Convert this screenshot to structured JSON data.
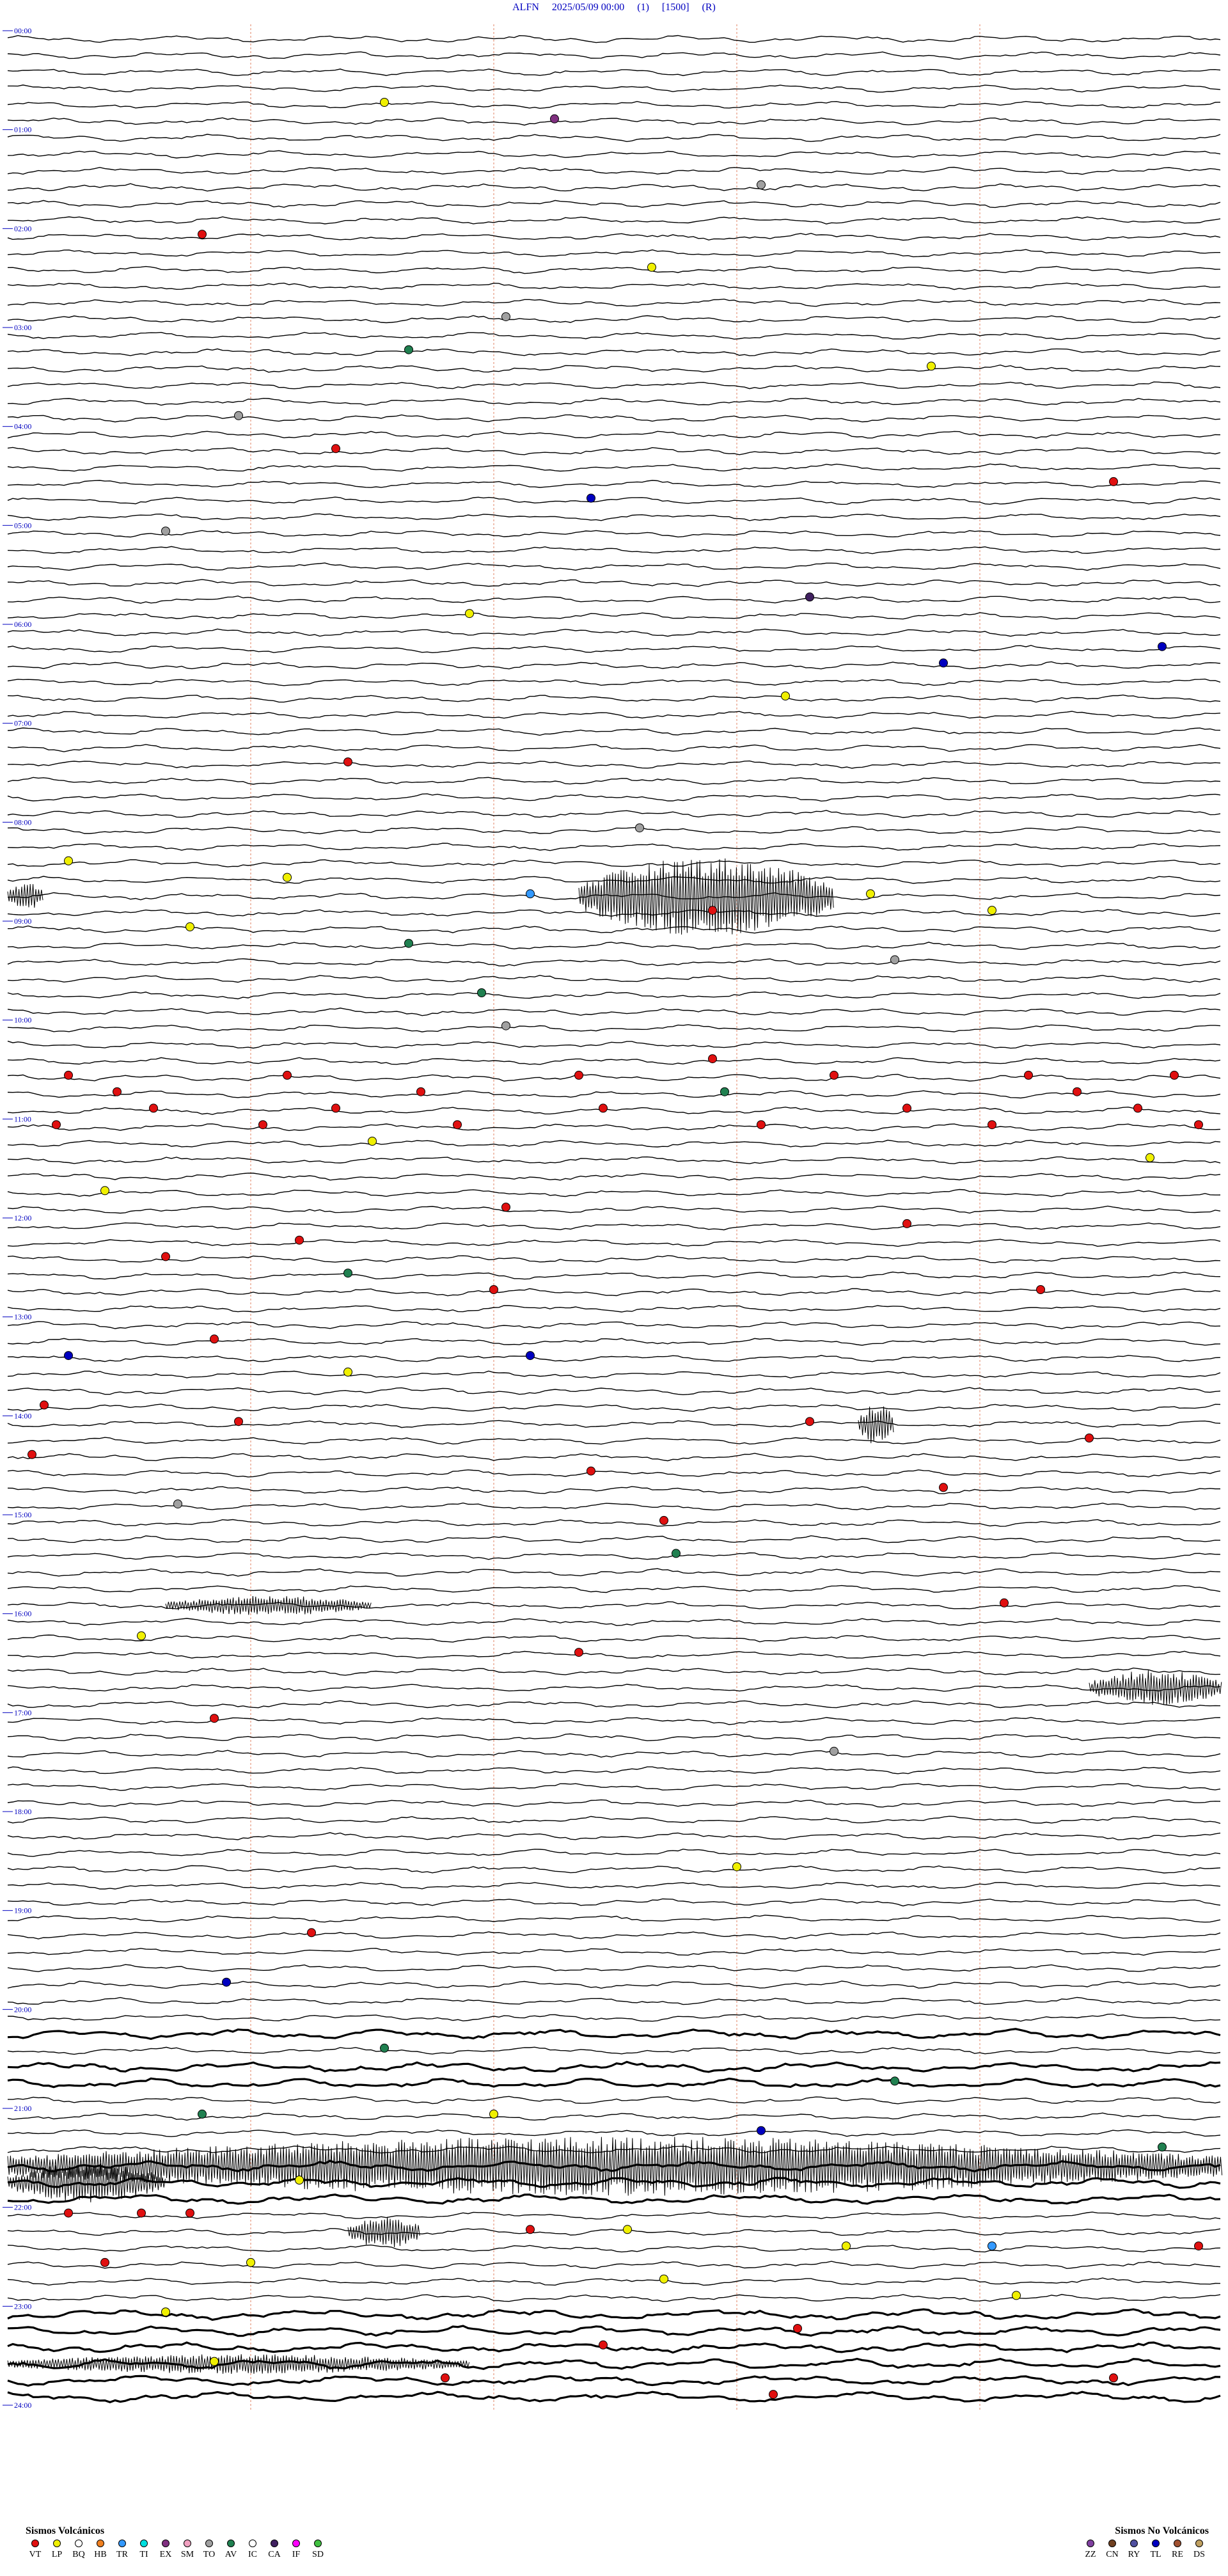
{
  "header": {
    "station": "ALFN",
    "datetime": "2025/05/09 00:00",
    "p1": "(1)",
    "p2": "[1500]",
    "p3": "(R)"
  },
  "chart_data": {
    "type": "line",
    "description_free": true,
    "traces_per_hour": 6,
    "row_count": 144,
    "hours": 24,
    "hour_labels": [
      "00:00",
      "01:00",
      "02:00",
      "03:00",
      "04:00",
      "05:00",
      "06:00",
      "07:00",
      "08:00",
      "09:00",
      "10:00",
      "11:00",
      "12:00",
      "13:00",
      "14:00",
      "15:00",
      "16:00",
      "17:00",
      "18:00",
      "19:00",
      "20:00",
      "21:00",
      "22:00",
      "23:00",
      "24:00"
    ],
    "x_minutes": [
      0,
      10
    ],
    "colors": {
      "VT": "#e01010",
      "LP": "#f0f000",
      "BQ": "#ffffff",
      "HB": "#f08020",
      "TR": "#3399ff",
      "TI": "#00e0e0",
      "EX": "#803080",
      "SM": "#f0a0c0",
      "TO": "#a0a0a0",
      "AV": "#208050",
      "IC": "#ffffff",
      "CA": "#402060",
      "IF": "#ff00ff",
      "SD": "#40c040",
      "ZZ": "#8040a0",
      "CN": "#704020",
      "RY": "#5050a0",
      "TL": "#0000c0",
      "RE": "#a05030",
      "DS": "#c0a060"
    },
    "events": [
      {
        "row": 4,
        "t": 3.1,
        "k": "LP"
      },
      {
        "row": 5,
        "t": 4.5,
        "k": "EX"
      },
      {
        "row": 9,
        "t": 6.2,
        "k": "TO"
      },
      {
        "row": 12,
        "t": 1.6,
        "k": "VT"
      },
      {
        "row": 14,
        "t": 5.3,
        "k": "LP"
      },
      {
        "row": 17,
        "t": 4.1,
        "k": "TO"
      },
      {
        "row": 19,
        "t": 3.3,
        "k": "AV"
      },
      {
        "row": 20,
        "t": 7.6,
        "k": "LP"
      },
      {
        "row": 23,
        "t": 1.9,
        "k": "TO"
      },
      {
        "row": 25,
        "t": 2.7,
        "k": "VT"
      },
      {
        "row": 27,
        "t": 9.1,
        "k": "VT"
      },
      {
        "row": 28,
        "t": 4.8,
        "k": "TL"
      },
      {
        "row": 30,
        "t": 1.3,
        "k": "TO"
      },
      {
        "row": 34,
        "t": 6.6,
        "k": "CA"
      },
      {
        "row": 35,
        "t": 3.8,
        "k": "LP"
      },
      {
        "row": 37,
        "t": 9.5,
        "k": "TL"
      },
      {
        "row": 38,
        "t": 7.7,
        "k": "TL"
      },
      {
        "row": 40,
        "t": 6.4,
        "k": "LP"
      },
      {
        "row": 44,
        "t": 2.8,
        "k": "VT"
      },
      {
        "row": 48,
        "t": 5.2,
        "k": "TO"
      },
      {
        "row": 50,
        "t": 0.5,
        "k": "LP"
      },
      {
        "row": 51,
        "t": 2.3,
        "k": "LP"
      },
      {
        "row": 52,
        "t": 4.3,
        "k": "TR"
      },
      {
        "row": 52,
        "t": 7.1,
        "k": "LP"
      },
      {
        "row": 53,
        "t": 5.8,
        "k": "VT"
      },
      {
        "row": 53,
        "t": 8.1,
        "k": "LP"
      },
      {
        "row": 54,
        "t": 1.5,
        "k": "LP"
      },
      {
        "row": 55,
        "t": 3.3,
        "k": "AV"
      },
      {
        "row": 56,
        "t": 7.3,
        "k": "TO"
      },
      {
        "row": 58,
        "t": 3.9,
        "k": "AV"
      },
      {
        "row": 60,
        "t": 4.1,
        "k": "TO"
      },
      {
        "row": 62,
        "t": 5.8,
        "k": "VT"
      },
      {
        "row": 63,
        "t": 0.5,
        "k": "VT"
      },
      {
        "row": 63,
        "t": 2.3,
        "k": "VT"
      },
      {
        "row": 63,
        "t": 4.7,
        "k": "VT"
      },
      {
        "row": 63,
        "t": 6.8,
        "k": "VT"
      },
      {
        "row": 63,
        "t": 8.4,
        "k": "VT"
      },
      {
        "row": 63,
        "t": 9.6,
        "k": "VT"
      },
      {
        "row": 64,
        "t": 0.9,
        "k": "VT"
      },
      {
        "row": 64,
        "t": 3.4,
        "k": "VT"
      },
      {
        "row": 64,
        "t": 5.9,
        "k": "AV"
      },
      {
        "row": 64,
        "t": 8.8,
        "k": "VT"
      },
      {
        "row": 65,
        "t": 1.2,
        "k": "VT"
      },
      {
        "row": 65,
        "t": 2.7,
        "k": "VT"
      },
      {
        "row": 65,
        "t": 4.9,
        "k": "VT"
      },
      {
        "row": 65,
        "t": 7.4,
        "k": "VT"
      },
      {
        "row": 65,
        "t": 9.3,
        "k": "VT"
      },
      {
        "row": 66,
        "t": 0.4,
        "k": "VT"
      },
      {
        "row": 66,
        "t": 2.1,
        "k": "VT"
      },
      {
        "row": 66,
        "t": 3.7,
        "k": "VT"
      },
      {
        "row": 66,
        "t": 6.2,
        "k": "VT"
      },
      {
        "row": 66,
        "t": 8.1,
        "k": "VT"
      },
      {
        "row": 66,
        "t": 9.8,
        "k": "VT"
      },
      {
        "row": 67,
        "t": 3.0,
        "k": "LP"
      },
      {
        "row": 68,
        "t": 9.4,
        "k": "LP"
      },
      {
        "row": 70,
        "t": 0.8,
        "k": "LP"
      },
      {
        "row": 71,
        "t": 4.1,
        "k": "VT"
      },
      {
        "row": 72,
        "t": 7.4,
        "k": "VT"
      },
      {
        "row": 73,
        "t": 2.4,
        "k": "VT"
      },
      {
        "row": 74,
        "t": 1.3,
        "k": "VT"
      },
      {
        "row": 75,
        "t": 2.8,
        "k": "AV"
      },
      {
        "row": 76,
        "t": 4.0,
        "k": "VT"
      },
      {
        "row": 76,
        "t": 8.5,
        "k": "VT"
      },
      {
        "row": 79,
        "t": 1.7,
        "k": "VT"
      },
      {
        "row": 80,
        "t": 0.5,
        "k": "TL"
      },
      {
        "row": 80,
        "t": 4.3,
        "k": "TL"
      },
      {
        "row": 81,
        "t": 2.8,
        "k": "LP"
      },
      {
        "row": 83,
        "t": 0.3,
        "k": "VT"
      },
      {
        "row": 84,
        "t": 1.9,
        "k": "VT"
      },
      {
        "row": 84,
        "t": 6.6,
        "k": "VT"
      },
      {
        "row": 85,
        "t": 8.9,
        "k": "VT"
      },
      {
        "row": 86,
        "t": 0.2,
        "k": "VT"
      },
      {
        "row": 87,
        "t": 4.8,
        "k": "VT"
      },
      {
        "row": 88,
        "t": 7.7,
        "k": "VT"
      },
      {
        "row": 89,
        "t": 1.4,
        "k": "TO"
      },
      {
        "row": 90,
        "t": 5.4,
        "k": "VT"
      },
      {
        "row": 92,
        "t": 5.5,
        "k": "AV"
      },
      {
        "row": 95,
        "t": 8.2,
        "k": "VT"
      },
      {
        "row": 97,
        "t": 1.1,
        "k": "LP"
      },
      {
        "row": 98,
        "t": 4.7,
        "k": "VT"
      },
      {
        "row": 102,
        "t": 1.7,
        "k": "VT"
      },
      {
        "row": 104,
        "t": 6.8,
        "k": "TO"
      },
      {
        "row": 111,
        "t": 6.0,
        "k": "LP"
      },
      {
        "row": 115,
        "t": 2.5,
        "k": "VT"
      },
      {
        "row": 118,
        "t": 1.8,
        "k": "TL"
      },
      {
        "row": 122,
        "t": 3.1,
        "k": "AV"
      },
      {
        "row": 124,
        "t": 7.3,
        "k": "AV"
      },
      {
        "row": 126,
        "t": 1.6,
        "k": "AV"
      },
      {
        "row": 126,
        "t": 4.0,
        "k": "LP"
      },
      {
        "row": 127,
        "t": 6.2,
        "k": "TL"
      },
      {
        "row": 128,
        "t": 9.5,
        "k": "AV"
      },
      {
        "row": 130,
        "t": 2.4,
        "k": "LP"
      },
      {
        "row": 132,
        "t": 0.5,
        "k": "VT"
      },
      {
        "row": 132,
        "t": 1.1,
        "k": "VT"
      },
      {
        "row": 132,
        "t": 1.5,
        "k": "VT"
      },
      {
        "row": 133,
        "t": 4.3,
        "k": "VT"
      },
      {
        "row": 133,
        "t": 5.1,
        "k": "LP"
      },
      {
        "row": 134,
        "t": 6.9,
        "k": "LP"
      },
      {
        "row": 134,
        "t": 8.1,
        "k": "TR"
      },
      {
        "row": 134,
        "t": 9.8,
        "k": "VT"
      },
      {
        "row": 135,
        "t": 0.8,
        "k": "VT"
      },
      {
        "row": 135,
        "t": 2.0,
        "k": "LP"
      },
      {
        "row": 136,
        "t": 5.4,
        "k": "LP"
      },
      {
        "row": 137,
        "t": 8.3,
        "k": "LP"
      },
      {
        "row": 138,
        "t": 1.3,
        "k": "LP"
      },
      {
        "row": 139,
        "t": 6.5,
        "k": "VT"
      },
      {
        "row": 140,
        "t": 4.9,
        "k": "VT"
      },
      {
        "row": 141,
        "t": 1.7,
        "k": "LP"
      },
      {
        "row": 142,
        "t": 3.6,
        "k": "VT"
      },
      {
        "row": 142,
        "t": 9.1,
        "k": "VT"
      },
      {
        "row": 143,
        "t": 6.3,
        "k": "VT"
      }
    ],
    "bursts": [
      {
        "row": 52,
        "t0": 4.7,
        "t1": 6.8,
        "amp": 2.4
      },
      {
        "row": 52,
        "t0": 0.0,
        "t1": 0.3,
        "amp": 0.9
      },
      {
        "row": 84,
        "t0": 7.0,
        "t1": 7.3,
        "amp": 1.3
      },
      {
        "row": 95,
        "t0": 1.3,
        "t1": 3.0,
        "amp": 0.6
      },
      {
        "row": 100,
        "t0": 8.9,
        "t1": 10.0,
        "amp": 1.1
      },
      {
        "row": 129,
        "t0": 0.0,
        "t1": 10.0,
        "amp": 1.8
      },
      {
        "row": 130,
        "t0": 0.0,
        "t1": 1.3,
        "amp": 1.2
      },
      {
        "row": 133,
        "t0": 2.8,
        "t1": 3.4,
        "amp": 1.0
      },
      {
        "row": 141,
        "t0": 0.0,
        "t1": 3.8,
        "amp": 0.6
      }
    ],
    "thick_rows": [
      121,
      123,
      124,
      129,
      130,
      131,
      138,
      139,
      140,
      141,
      142,
      143
    ]
  },
  "legend": {
    "volcanic_title": "Sismos Volcánicos",
    "volcanic": [
      "VT",
      "LP",
      "BQ",
      "HB",
      "TR",
      "TI",
      "EX",
      "SM",
      "TO",
      "AV",
      "IC",
      "CA",
      "IF",
      "SD"
    ],
    "nonvolcanic_title": "Sismos No Volcánicos",
    "nonvolcanic": [
      "ZZ",
      "CN",
      "RY",
      "TL",
      "RE",
      "DS"
    ]
  }
}
